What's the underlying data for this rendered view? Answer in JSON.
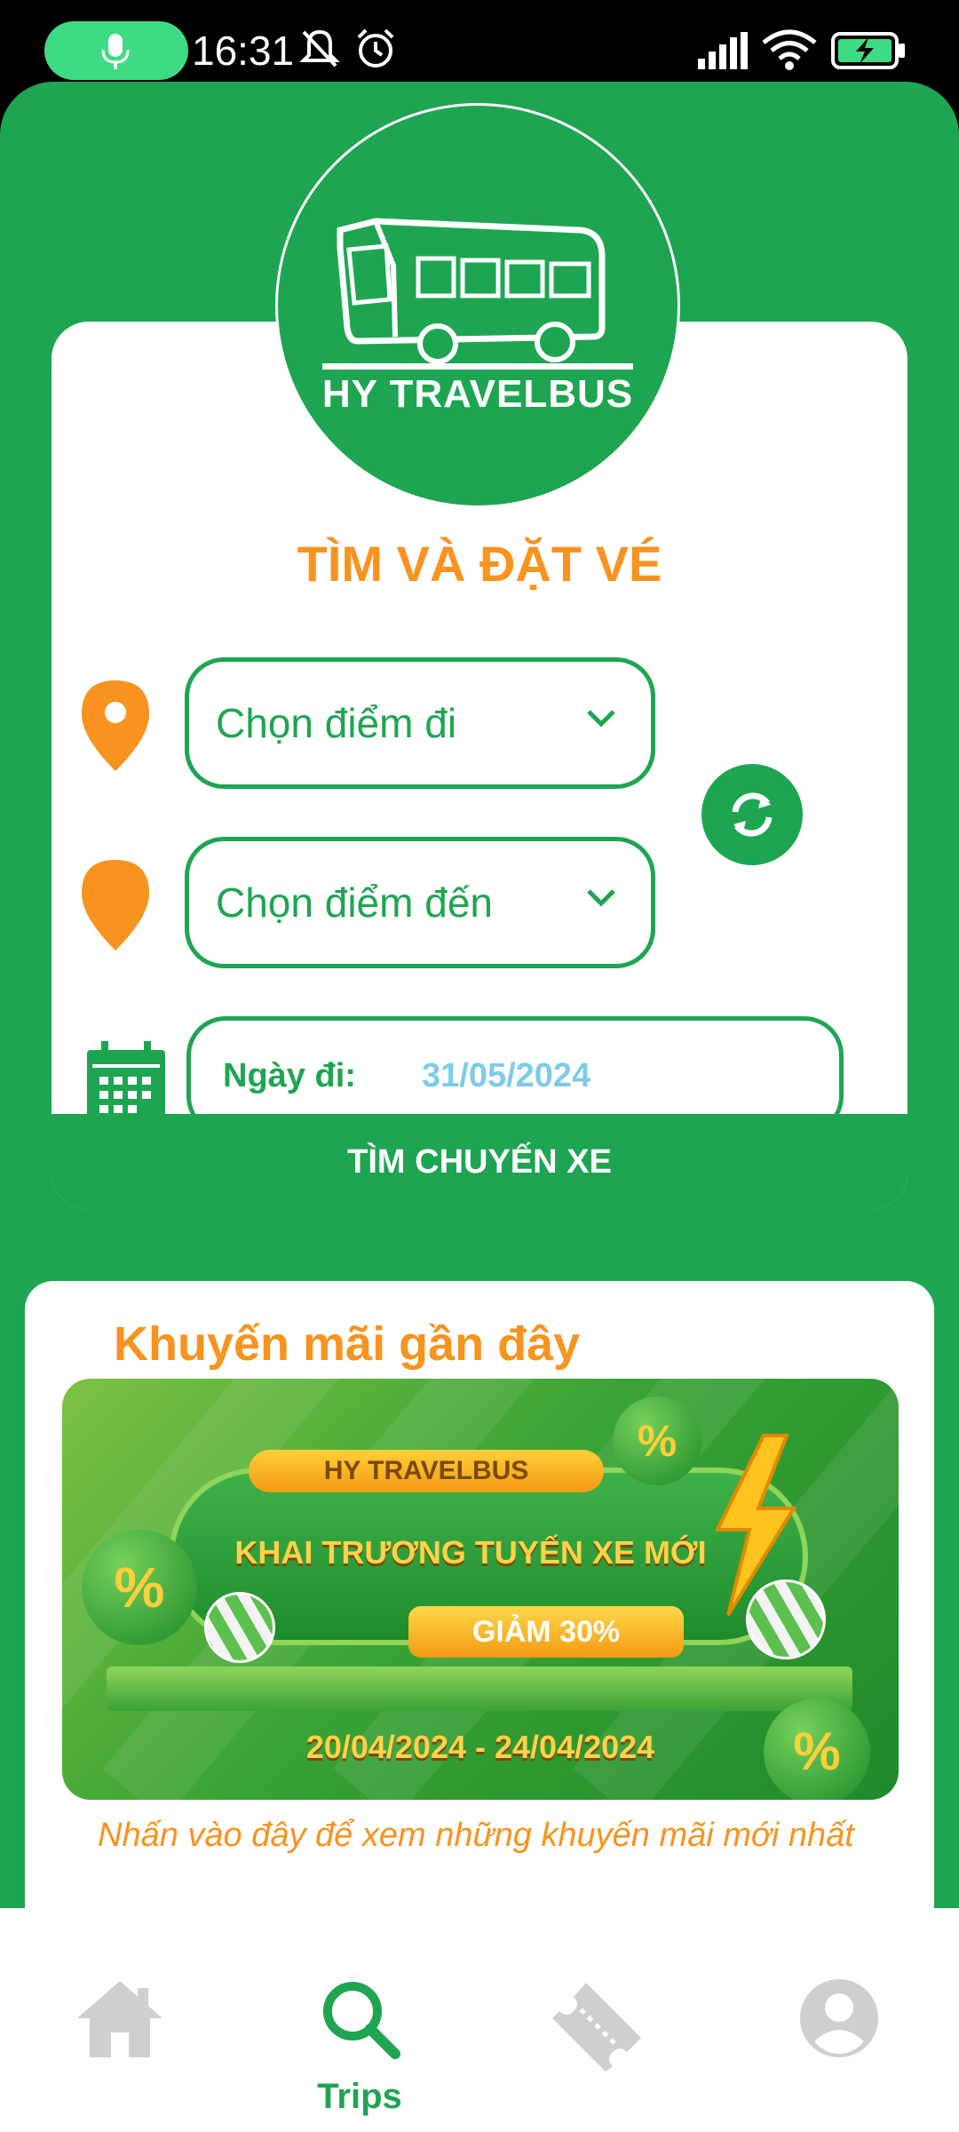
{
  "status_bar": {
    "time": "16:31"
  },
  "brand": {
    "name": "HY TRAVELBUS"
  },
  "search": {
    "title": "TÌM VÀ ĐẶT VÉ",
    "origin_placeholder": "Chọn điểm đi",
    "destination_placeholder": "Chọn điểm đến",
    "date_label": "Ngày đi:",
    "date_value": "31/05/2024",
    "submit_label": "TÌM CHUYẾN XE"
  },
  "promotions": {
    "title": "Khuyến mãi gần đây",
    "banner": {
      "brand": "HY TRAVELBUS",
      "headline": "KHAI TRƯƠNG TUYẾN XE MỚI",
      "discount": "GIẢM 30%",
      "dates": "20/04/2024 - 24/04/2024"
    },
    "link_text": "Nhấn vào đây để xem những khuyến mãi mới nhất"
  },
  "bottom_nav": {
    "items": [
      {
        "icon": "home-icon",
        "label": ""
      },
      {
        "icon": "search-icon",
        "label": "Trips",
        "active": true
      },
      {
        "icon": "ticket-icon",
        "label": ""
      },
      {
        "icon": "account-icon",
        "label": ""
      }
    ]
  },
  "colors": {
    "primary_green": "#1ea551",
    "accent_orange": "#f7931e",
    "date_blue": "#7fcbe8",
    "inactive_gray": "#cfcfcf"
  }
}
